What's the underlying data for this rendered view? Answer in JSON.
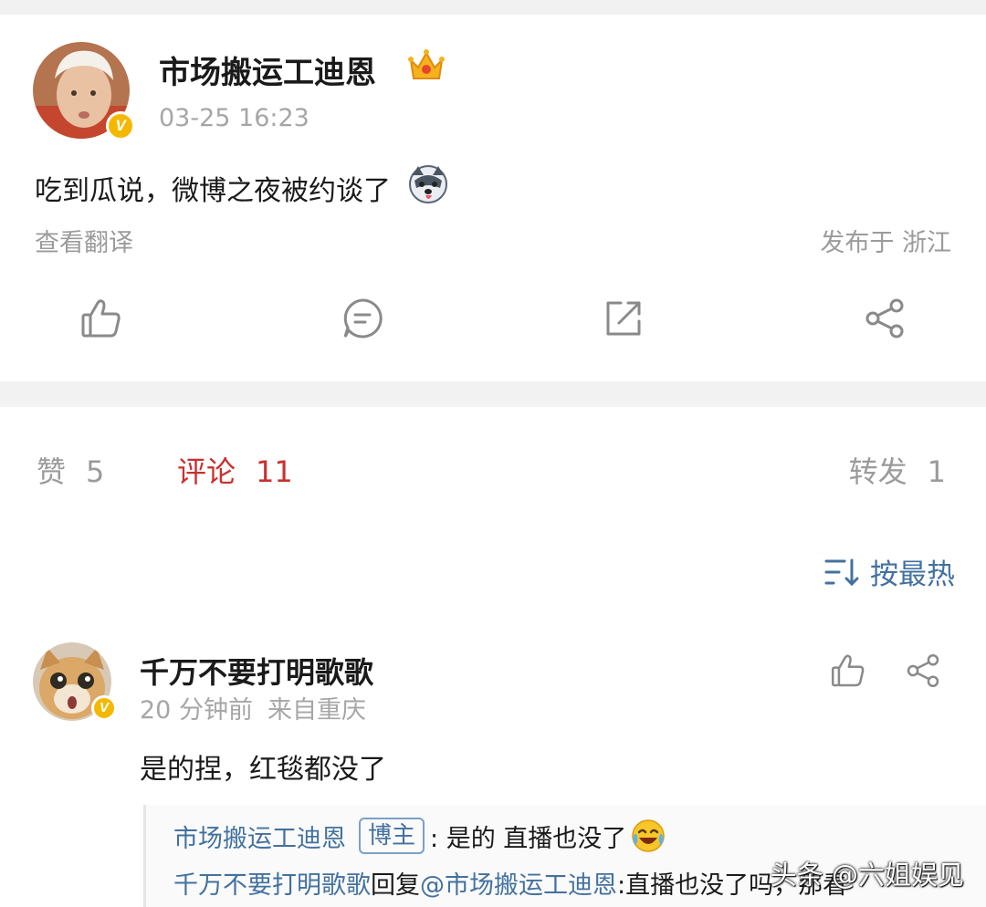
{
  "post": {
    "author": "市场搬运工迪恩",
    "time": "03-25 16:23",
    "text": "吃到瓜说，微博之夜被约谈了",
    "translate": "查看翻译",
    "location": "发布于 浙江"
  },
  "stats": {
    "like_label": "赞",
    "like_count": "5",
    "comment_label": "评论",
    "comment_count": "11",
    "repost_label": "转发",
    "repost_count": "1"
  },
  "sort": {
    "label": "按最热"
  },
  "comment": {
    "author": "千万不要打明歌歌",
    "time": "20 分钟前",
    "source": "来自重庆",
    "text": "是的捏，红毯都没了",
    "replies": [
      {
        "author": "市场搬运工迪恩",
        "tag": "博主",
        "text": ": 是的 直播也没了"
      },
      {
        "author": "千万不要打明歌歌",
        "reply_word": " 回复",
        "target": "@市场搬运工迪恩",
        "text": " :直播也没了吗，那看"
      }
    ]
  },
  "watermark": "头条 @六姐娱见",
  "colors": {
    "accent_red": "#c8312f",
    "link_blue": "#43719f",
    "gray_text": "#9b9b9b",
    "badge_gold": "#f5b800"
  },
  "icons": [
    "crown-icon",
    "dog-emoji-icon",
    "like-icon",
    "comment-icon",
    "repost-icon",
    "share-icon",
    "sort-icon",
    "laugh-cry-emoji-icon",
    "verified-badge-icon"
  ]
}
